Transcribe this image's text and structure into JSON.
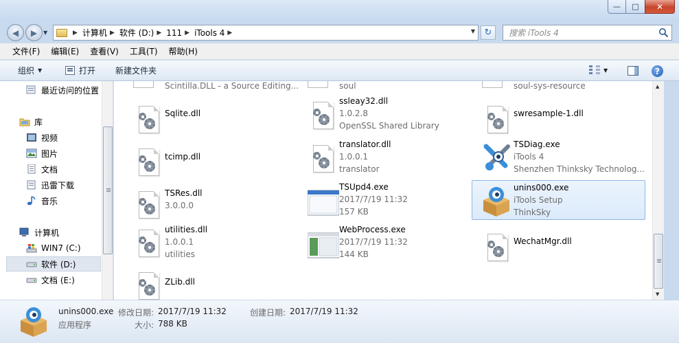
{
  "window": {
    "minimize_glyph": "—",
    "maximize_glyph": "□",
    "close_glyph": "✕"
  },
  "address": {
    "breadcrumbs": [
      "计算机",
      "软件 (D:)",
      "111",
      "iTools 4"
    ],
    "search_placeholder": "搜索 iTools 4"
  },
  "menu": [
    "文件(F)",
    "编辑(E)",
    "查看(V)",
    "工具(T)",
    "帮助(H)"
  ],
  "toolbar": {
    "organize": "组织",
    "open": "打开",
    "new_folder": "新建文件夹",
    "help_glyph": "?"
  },
  "nav": {
    "recent": "最近访问的位置",
    "libraries": "库",
    "videos": "视频",
    "pictures": "图片",
    "documents": "文档",
    "thunder": "迅雷下载",
    "music": "音乐",
    "computer": "计算机",
    "drive_c": "WIN7 (C:)",
    "drive_d": "软件 (D:)",
    "drive_e": "文档 (E:)"
  },
  "files": {
    "partial": [
      {
        "name": "Scintilla.DLL - a Source Editing..."
      },
      {
        "name": "soul"
      },
      {
        "name": "soul-sys-resource"
      }
    ],
    "col1": [
      {
        "name": "Sqlite.dll"
      },
      {
        "name": "tcimp.dll"
      },
      {
        "name": "TSRes.dll",
        "line2": "3.0.0.0"
      },
      {
        "name": "utilities.dll",
        "line2": "1.0.0.1",
        "line3": "utilities"
      },
      {
        "name": "ZLib.dll"
      }
    ],
    "col2": [
      {
        "name": "ssleay32.dll",
        "line2": "1.0.2.8",
        "line3": "OpenSSL Shared Library"
      },
      {
        "name": "translator.dll",
        "line2": "1.0.0.1",
        "line3": "translator"
      },
      {
        "name": "TSUpd4.exe",
        "line2": "2017/7/19 11:32",
        "line3": "157 KB"
      },
      {
        "name": "WebProcess.exe",
        "line2": "2017/7/19 11:32",
        "line3": "144 KB"
      }
    ],
    "col3": [
      {
        "name": "swresample-1.dll"
      },
      {
        "name": "TSDiag.exe",
        "line2": "iTools 4",
        "line3": "Shenzhen Thinksky Technolog..."
      },
      {
        "name": "unins000.exe",
        "line2": "iTools Setup",
        "line3": "ThinkSky"
      },
      {
        "name": "WechatMgr.dll"
      }
    ]
  },
  "status": {
    "filename": "unins000.exe",
    "type": "应用程序",
    "modified_label": "修改日期:",
    "modified_value": "2017/7/19 11:32",
    "created_label": "创建日期:",
    "created_value": "2017/7/19 11:32",
    "size_label": "大小:",
    "size_value": "788 KB"
  },
  "colors": {
    "selection_fill": "#dbeafb",
    "selection_border": "#8fb5e6"
  }
}
